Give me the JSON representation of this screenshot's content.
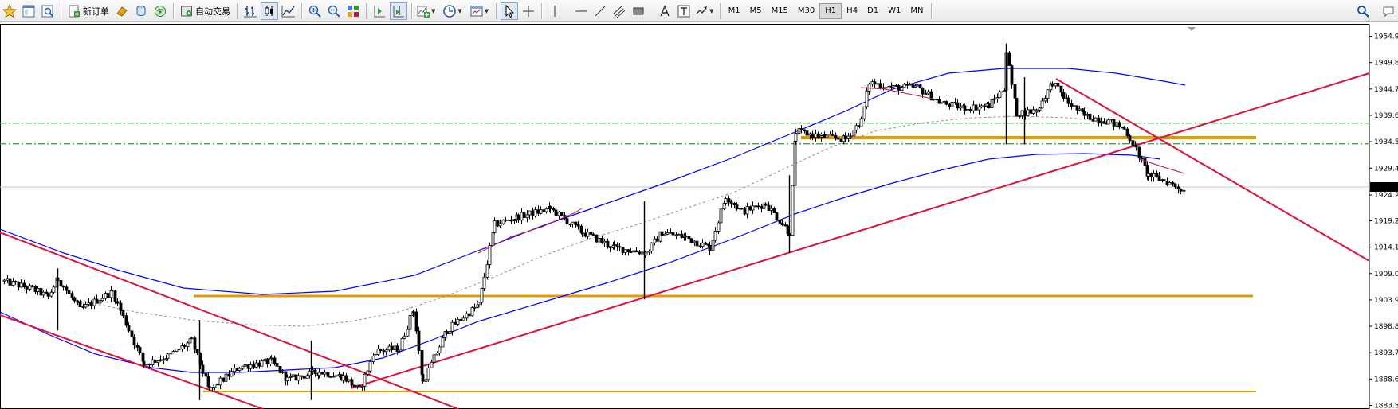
{
  "toolbar": {
    "new_order_label": "新订单",
    "auto_trading_label": "自动交易",
    "timeframes": [
      "M1",
      "M5",
      "M15",
      "M30",
      "H1",
      "H4",
      "D1",
      "W1",
      "MN"
    ],
    "active_timeframe": "H1"
  },
  "chart_data": {
    "type": "candlestick",
    "price_scale": {
      "ticks": [
        "1954.9",
        "1949.8",
        "1944.7",
        "1939.6",
        "1934.5",
        "1929.4",
        "1924.2",
        "1919.2",
        "1914.1",
        "1909.0",
        "1903.9",
        "1898.8",
        "1893.7",
        "1888.6",
        "1883.5"
      ],
      "range": [
        1882.8,
        1957.3
      ]
    },
    "current_price": "1925.0",
    "colors": {
      "candles": "#000000",
      "bollinger_bands": "#0000ff",
      "moving_average": "#c0144c",
      "middle_band": "#8a8a8a",
      "support_resistance": "#e59a00",
      "trend_lines": "#e0103c",
      "dash_dot_levels": "#2e9c2e",
      "grid_line": "#c8c8c8",
      "price_label_bg": "#000000"
    },
    "horizontal_levels": {
      "dash_dot": [
        1938.1,
        1934.1
      ],
      "support_resistance": [
        1903.9,
        1885.6,
        1935.0
      ]
    }
  }
}
